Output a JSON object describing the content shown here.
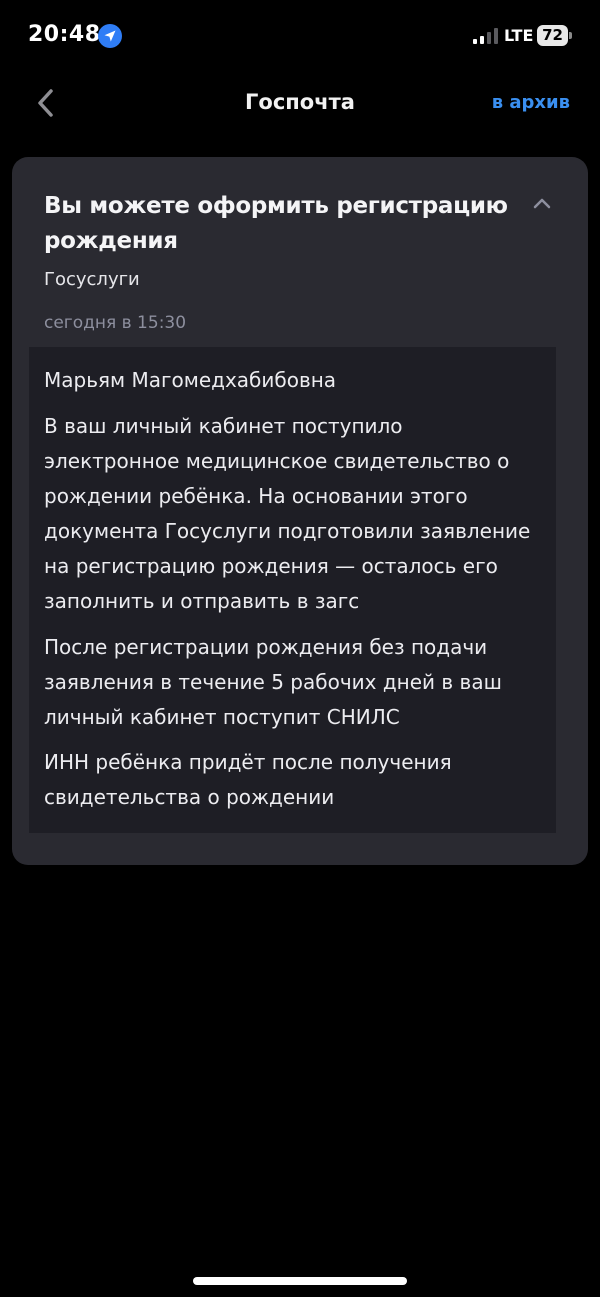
{
  "status_bar": {
    "time": "20:48",
    "network": "LTE",
    "battery": "72"
  },
  "header": {
    "title": "Госпочта",
    "archive_label": "в архив"
  },
  "message": {
    "title": "Вы можете оформить регистрацию рождения",
    "sender": "Госуслуги",
    "time": "сегодня в 15:30",
    "greeting": "Марьям Магомедхабибовна",
    "paragraphs": [
      "В ваш личный кабинет поступило электронное медицинское свидетельство о рождении ребёнка. На основании этого документа Госуслуги подготовили заявление на регистрацию рождения — осталось его заполнить и отправить в загс",
      "После регистрации рождения без подачи заявления в течение 5 рабочих дней в ваш личный кабинет поступит СНИЛС",
      "ИНН ребёнка придёт после получения свидетельства о рождении"
    ]
  },
  "icons": {
    "back": "chevron-left-icon",
    "collapse": "chevron-up-icon",
    "location": "location-arrow-icon",
    "signal": "signal-bars-icon",
    "battery": "battery-icon"
  },
  "colors": {
    "background": "#000000",
    "card": "#2a2a31",
    "message_body": "#1e1e25",
    "accent": "#3a8ff0",
    "muted_text": "#8d8f9e",
    "location_badge": "#2f7df6"
  }
}
